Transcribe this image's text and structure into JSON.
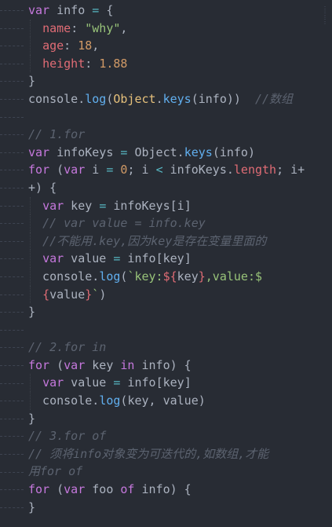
{
  "colors": {
    "background": "#282c34",
    "keyword": "#c678dd",
    "property": "#e06c75",
    "string": "#98c379",
    "number": "#d19a66",
    "function": "#61afef",
    "comment": "#5c6370"
  },
  "minimap_icon": "scroll-indicator-icon",
  "lines": [
    [
      [
        "kw",
        "var"
      ],
      [
        "id",
        " info "
      ],
      [
        "op",
        "="
      ],
      [
        "pun",
        " {"
      ]
    ],
    [
      [
        "id",
        "  "
      ],
      [
        "prop",
        "name"
      ],
      [
        "pun",
        ": "
      ],
      [
        "str",
        "\"why\""
      ],
      [
        "pun",
        ","
      ]
    ],
    [
      [
        "id",
        "  "
      ],
      [
        "prop",
        "age"
      ],
      [
        "pun",
        ": "
      ],
      [
        "num",
        "18"
      ],
      [
        "pun",
        ","
      ]
    ],
    [
      [
        "id",
        "  "
      ],
      [
        "prop",
        "height"
      ],
      [
        "pun",
        ": "
      ],
      [
        "num",
        "1.88"
      ]
    ],
    [
      [
        "pun",
        "}"
      ]
    ],
    [
      [
        "id",
        "console"
      ],
      [
        "pun",
        "."
      ],
      [
        "fn",
        "log"
      ],
      [
        "pun",
        "("
      ],
      [
        "obj",
        "Object"
      ],
      [
        "pun",
        "."
      ],
      [
        "fn",
        "keys"
      ],
      [
        "pun",
        "("
      ],
      [
        "id",
        "info"
      ],
      [
        "pun",
        "))"
      ],
      [
        "cm",
        "  //数组"
      ]
    ],
    [
      [
        "id",
        ""
      ]
    ],
    [
      [
        "cm",
        "// 1.for"
      ]
    ],
    [
      [
        "kw",
        "var"
      ],
      [
        "id",
        " infoKeys "
      ],
      [
        "op",
        "="
      ],
      [
        "id",
        " Object"
      ],
      [
        "pun",
        "."
      ],
      [
        "fn",
        "keys"
      ],
      [
        "pun",
        "("
      ],
      [
        "id",
        "info"
      ],
      [
        "pun",
        ")"
      ]
    ],
    [
      [
        "kw",
        "for"
      ],
      [
        "pun",
        " ("
      ],
      [
        "kw",
        "var"
      ],
      [
        "id",
        " i "
      ],
      [
        "op",
        "="
      ],
      [
        "num",
        " 0"
      ],
      [
        "pun",
        "; "
      ],
      [
        "id",
        "i "
      ],
      [
        "op",
        "<"
      ],
      [
        "id",
        " infoKeys"
      ],
      [
        "pun",
        "."
      ],
      [
        "prop",
        "length"
      ],
      [
        "pun",
        "; "
      ],
      [
        "id",
        "i+"
      ]
    ],
    [
      [
        "id",
        "+"
      ],
      [
        "pun",
        ") {"
      ]
    ],
    [
      [
        "id",
        "  "
      ],
      [
        "kw",
        "var"
      ],
      [
        "id",
        " key "
      ],
      [
        "op",
        "="
      ],
      [
        "id",
        " infoKeys"
      ],
      [
        "pun",
        "["
      ],
      [
        "id",
        "i"
      ],
      [
        "pun",
        "]"
      ]
    ],
    [
      [
        "id",
        "  "
      ],
      [
        "cm",
        "// var value = info.key"
      ]
    ],
    [
      [
        "id",
        "  "
      ],
      [
        "cm",
        "//不能用.key,因为key是存在变量里面的"
      ]
    ],
    [
      [
        "id",
        "  "
      ],
      [
        "kw",
        "var"
      ],
      [
        "id",
        " value "
      ],
      [
        "op",
        "="
      ],
      [
        "id",
        " info"
      ],
      [
        "pun",
        "["
      ],
      [
        "id",
        "key"
      ],
      [
        "pun",
        "]"
      ]
    ],
    [
      [
        "id",
        "  console"
      ],
      [
        "pun",
        "."
      ],
      [
        "fn",
        "log"
      ],
      [
        "pun",
        "("
      ],
      [
        "tpl",
        "`key:"
      ],
      [
        "tplx",
        "${"
      ],
      [
        "id",
        "key"
      ],
      [
        "tplx",
        "}"
      ],
      [
        "tpl",
        ",value:$"
      ]
    ],
    [
      [
        "id",
        "  "
      ],
      [
        "tplx",
        "{"
      ],
      [
        "id",
        "value"
      ],
      [
        "tplx",
        "}"
      ],
      [
        "tpl",
        "`"
      ],
      [
        "pun",
        ")"
      ]
    ],
    [
      [
        "pun",
        "}"
      ]
    ],
    [
      [
        "id",
        ""
      ]
    ],
    [
      [
        "cm",
        "// 2.for in"
      ]
    ],
    [
      [
        "kw",
        "for"
      ],
      [
        "pun",
        " ("
      ],
      [
        "kw",
        "var"
      ],
      [
        "id",
        " key "
      ],
      [
        "kw",
        "in"
      ],
      [
        "id",
        " info"
      ],
      [
        "pun",
        ") {"
      ]
    ],
    [
      [
        "id",
        "  "
      ],
      [
        "kw",
        "var"
      ],
      [
        "id",
        " value "
      ],
      [
        "op",
        "="
      ],
      [
        "id",
        " info"
      ],
      [
        "pun",
        "["
      ],
      [
        "id",
        "key"
      ],
      [
        "pun",
        "]"
      ]
    ],
    [
      [
        "id",
        "  console"
      ],
      [
        "pun",
        "."
      ],
      [
        "fn",
        "log"
      ],
      [
        "pun",
        "("
      ],
      [
        "id",
        "key, value"
      ],
      [
        "pun",
        ")"
      ]
    ],
    [
      [
        "pun",
        "}"
      ]
    ],
    [
      [
        "cm",
        "// 3.for of"
      ]
    ],
    [
      [
        "cm",
        "// 须将info对象变为可迭代的,如数组,才能"
      ]
    ],
    [
      [
        "cm",
        "用for of"
      ]
    ],
    [
      [
        "kw",
        "for"
      ],
      [
        "pun",
        " ("
      ],
      [
        "kw",
        "var"
      ],
      [
        "id",
        " foo "
      ],
      [
        "kw",
        "of"
      ],
      [
        "id",
        " info"
      ],
      [
        "pun",
        ") {"
      ]
    ],
    [
      [
        "pun",
        "}"
      ]
    ]
  ],
  "indent_guides": [
    1,
    2,
    3,
    11,
    12,
    13,
    14,
    15,
    16,
    21,
    22
  ]
}
